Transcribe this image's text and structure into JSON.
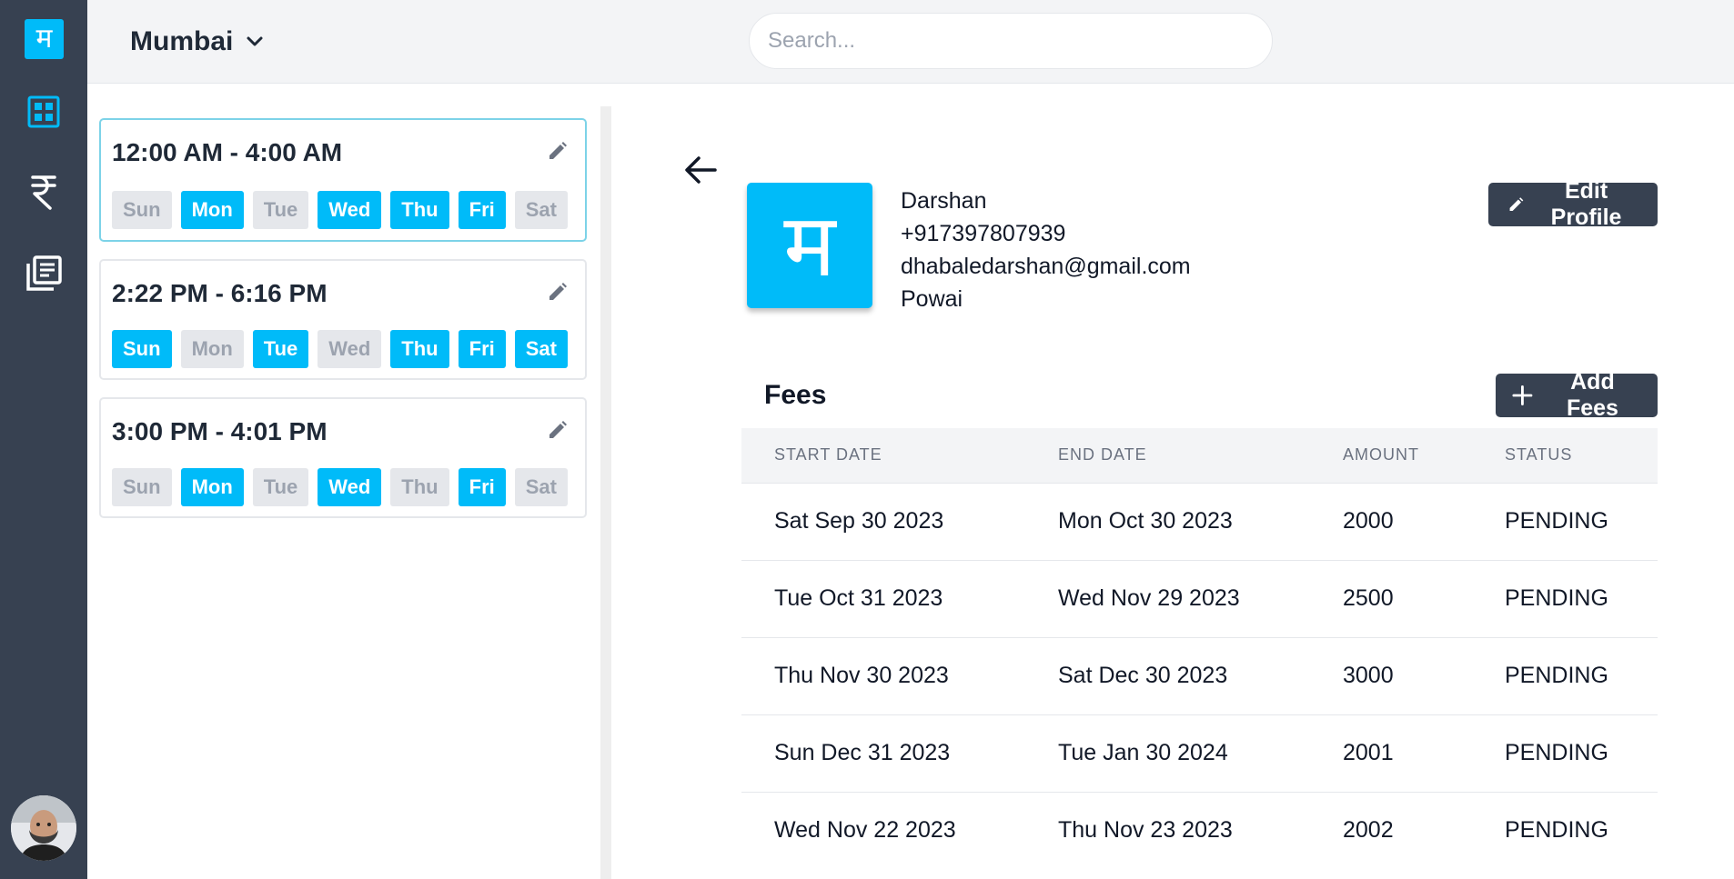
{
  "brand": {
    "logo_glyph": "म",
    "accent_color": "#00bbf9",
    "sidebar_color": "#374151"
  },
  "sidebar": {
    "items": [
      {
        "name": "dashboard",
        "icon": "grid-icon",
        "active": true
      },
      {
        "name": "fees",
        "icon": "rupee-icon",
        "active": false
      },
      {
        "name": "library",
        "icon": "library-icon",
        "active": false
      }
    ]
  },
  "header": {
    "city": "Mumbai",
    "search": {
      "placeholder": "Search...",
      "value": ""
    }
  },
  "schedule": {
    "slots": [
      {
        "time": "12:00 AM - 4:00 AM",
        "selected": true,
        "days": [
          {
            "label": "Sun",
            "on": false
          },
          {
            "label": "Mon",
            "on": true
          },
          {
            "label": "Tue",
            "on": false
          },
          {
            "label": "Wed",
            "on": true
          },
          {
            "label": "Thu",
            "on": true
          },
          {
            "label": "Fri",
            "on": true
          },
          {
            "label": "Sat",
            "on": false
          }
        ]
      },
      {
        "time": "2:22 PM - 6:16 PM",
        "selected": false,
        "days": [
          {
            "label": "Sun",
            "on": true
          },
          {
            "label": "Mon",
            "on": false
          },
          {
            "label": "Tue",
            "on": true
          },
          {
            "label": "Wed",
            "on": false
          },
          {
            "label": "Thu",
            "on": true
          },
          {
            "label": "Fri",
            "on": true
          },
          {
            "label": "Sat",
            "on": true
          }
        ]
      },
      {
        "time": "3:00 PM - 4:01 PM",
        "selected": false,
        "days": [
          {
            "label": "Sun",
            "on": false
          },
          {
            "label": "Mon",
            "on": true
          },
          {
            "label": "Tue",
            "on": false
          },
          {
            "label": "Wed",
            "on": true
          },
          {
            "label": "Thu",
            "on": false
          },
          {
            "label": "Fri",
            "on": true
          },
          {
            "label": "Sat",
            "on": false
          }
        ]
      }
    ]
  },
  "profile": {
    "avatar_glyph": "म",
    "name": "Darshan",
    "phone": "+917397807939",
    "email": "dhabaledarshan@gmail.com",
    "location": "Powai",
    "edit_label": "Edit Profile"
  },
  "fees": {
    "title": "Fees",
    "add_label": "Add Fees",
    "columns": [
      "START DATE",
      "END DATE",
      "AMOUNT",
      "STATUS"
    ],
    "rows": [
      {
        "start": "Sat Sep 30 2023",
        "end": "Mon Oct 30 2023",
        "amount": "2000",
        "status": "PENDING"
      },
      {
        "start": "Tue Oct 31 2023",
        "end": "Wed Nov 29 2023",
        "amount": "2500",
        "status": "PENDING"
      },
      {
        "start": "Thu Nov 30 2023",
        "end": "Sat Dec 30 2023",
        "amount": "3000",
        "status": "PENDING"
      },
      {
        "start": "Sun Dec 31 2023",
        "end": "Tue Jan 30 2024",
        "amount": "2001",
        "status": "PENDING"
      },
      {
        "start": "Wed Nov 22 2023",
        "end": "Thu Nov 23 2023",
        "amount": "2002",
        "status": "PENDING"
      }
    ]
  }
}
